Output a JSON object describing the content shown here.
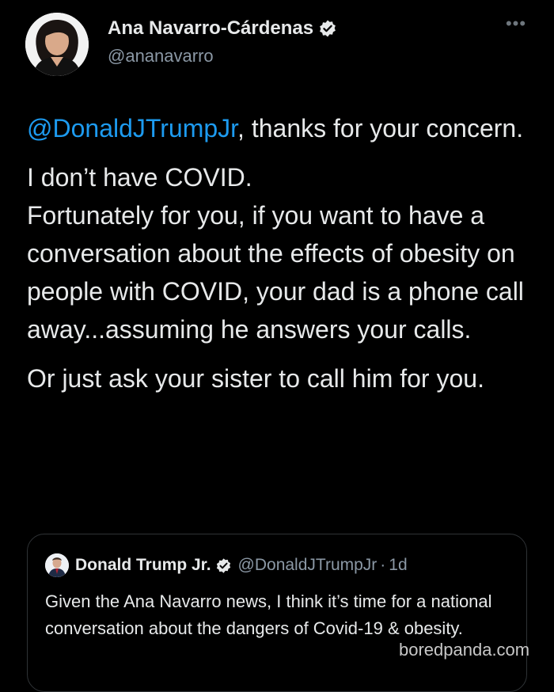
{
  "tweet": {
    "author": {
      "display_name": "Ana Navarro-Cárdenas",
      "handle": "@ananavarro",
      "verified_icon": "verified-badge-icon"
    },
    "more_icon": "•••",
    "body": {
      "mention": "@DonaldJTrumpJr",
      "p1_rest": ", thanks for your concern.",
      "p2_line1": "I don’t have COVID.",
      "p2_line2": "Fortunately for you, if you want to have a conversation about the effects of obesity on people with COVID, your dad is a phone call away...assuming he answers your calls.",
      "p3": "Or just ask your sister to call him for you."
    },
    "quoted_tweet": {
      "display_name": "Donald Trump Jr.",
      "handle": "@DonaldJTrumpJr",
      "separator": "·",
      "time": "1d",
      "text": "Given the Ana Navarro news, I think it’s time for a national conversation about the dangers of Covid-19 & obesity."
    }
  },
  "watermark": "boredpanda.com",
  "colors": {
    "background": "#000000",
    "text_primary": "#e7e9ea",
    "text_secondary": "#8b98a5",
    "link": "#1d9bf0",
    "verified": "#e7e9ea",
    "border": "#2f3336"
  }
}
